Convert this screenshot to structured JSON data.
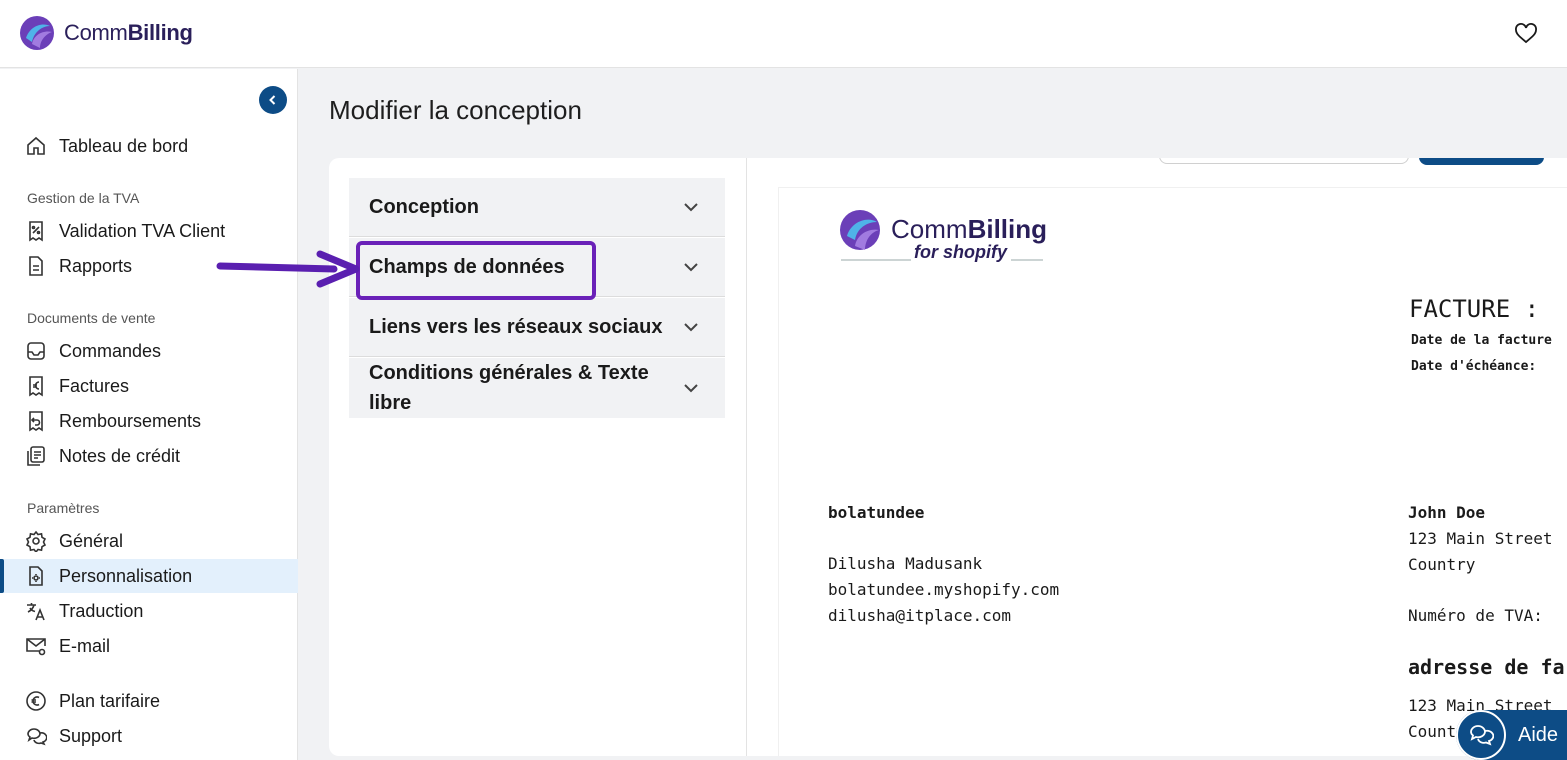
{
  "header": {
    "brand_prefix": "Comm",
    "brand_suffix": "Billing",
    "favorite_icon": "heart-icon"
  },
  "sidebar": {
    "sections": {
      "vat": "Gestion de la TVA",
      "sales": "Documents de vente",
      "settings": "Paramètres"
    },
    "items": [
      {
        "label": "Tableau de bord",
        "icon": "home-icon"
      },
      {
        "label": "Validation TVA Client",
        "icon": "percent-receipt-icon"
      },
      {
        "label": "Rapports",
        "icon": "document-icon"
      },
      {
        "label": "Commandes",
        "icon": "inbox-icon"
      },
      {
        "label": "Factures",
        "icon": "euro-receipt-icon"
      },
      {
        "label": "Remboursements",
        "icon": "refund-receipt-icon"
      },
      {
        "label": "Notes de crédit",
        "icon": "notes-icon"
      },
      {
        "label": "Général",
        "icon": "gear-icon"
      },
      {
        "label": "Personnalisation",
        "icon": "customize-icon",
        "active": true
      },
      {
        "label": "Traduction",
        "icon": "translate-icon"
      },
      {
        "label": "E-mail",
        "icon": "mail-settings-icon"
      },
      {
        "label": "Plan tarifaire",
        "icon": "euro-circle-icon"
      },
      {
        "label": "Support",
        "icon": "chat-icon"
      }
    ]
  },
  "main": {
    "title": "Modifier la conception",
    "accordion": [
      "Conception",
      "Champs de données",
      "Liens vers les réseaux sociaux",
      "Conditions générales & Texte libre"
    ]
  },
  "preview": {
    "logo_prefix": "Comm",
    "logo_suffix": "Billing",
    "logo_tagline": "for shopify",
    "invoice_title": "FACTURE :",
    "invoice_date_label": "Date de la facture",
    "due_date_label": "Date d'échéance:",
    "shop_name": "bolatundee",
    "shop_owner": "Dilusha Madusank",
    "shop_domain": "bolatundee.myshopify.com",
    "shop_email": "dilusha@itplace.com",
    "customer_name": "John Doe",
    "customer_street": "123 Main Street",
    "customer_country": "Country",
    "vat_number_label": "Numéro de TVA:",
    "billing_address_heading": "adresse de fa",
    "billing_street": "123 Main Street",
    "billing_country": "Count"
  },
  "help": {
    "label": "Aide",
    "icon": "chat-bubbles-icon"
  }
}
